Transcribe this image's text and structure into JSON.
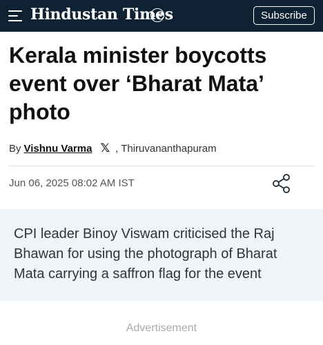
{
  "header": {
    "logo_text": "Hindustan Times",
    "logo_badge": "100",
    "subscribe_label": "Subscribe",
    "icons": {
      "menu": "hamburger-menu-icon"
    }
  },
  "article": {
    "headline": "Kerala minister boycotts event over ‘Bharat Mata’ photo",
    "byline_prefix": "By",
    "author": "Vishnu Varma",
    "location": ", Thiruvananthapuram",
    "date": "Jun 06, 2025 08:02 AM IST",
    "summary": "CPI leader Binoy Viswam criticised the Raj Bhawan for using the photograph of Bharat Mata carrying a saffron flag for the event",
    "icons": {
      "author_social": "x-icon",
      "share": "share-icon"
    }
  },
  "advertisement_label": "Advertisement",
  "colors": {
    "header_bg": "#0f2233",
    "summary_bg": "#eef4f7"
  }
}
